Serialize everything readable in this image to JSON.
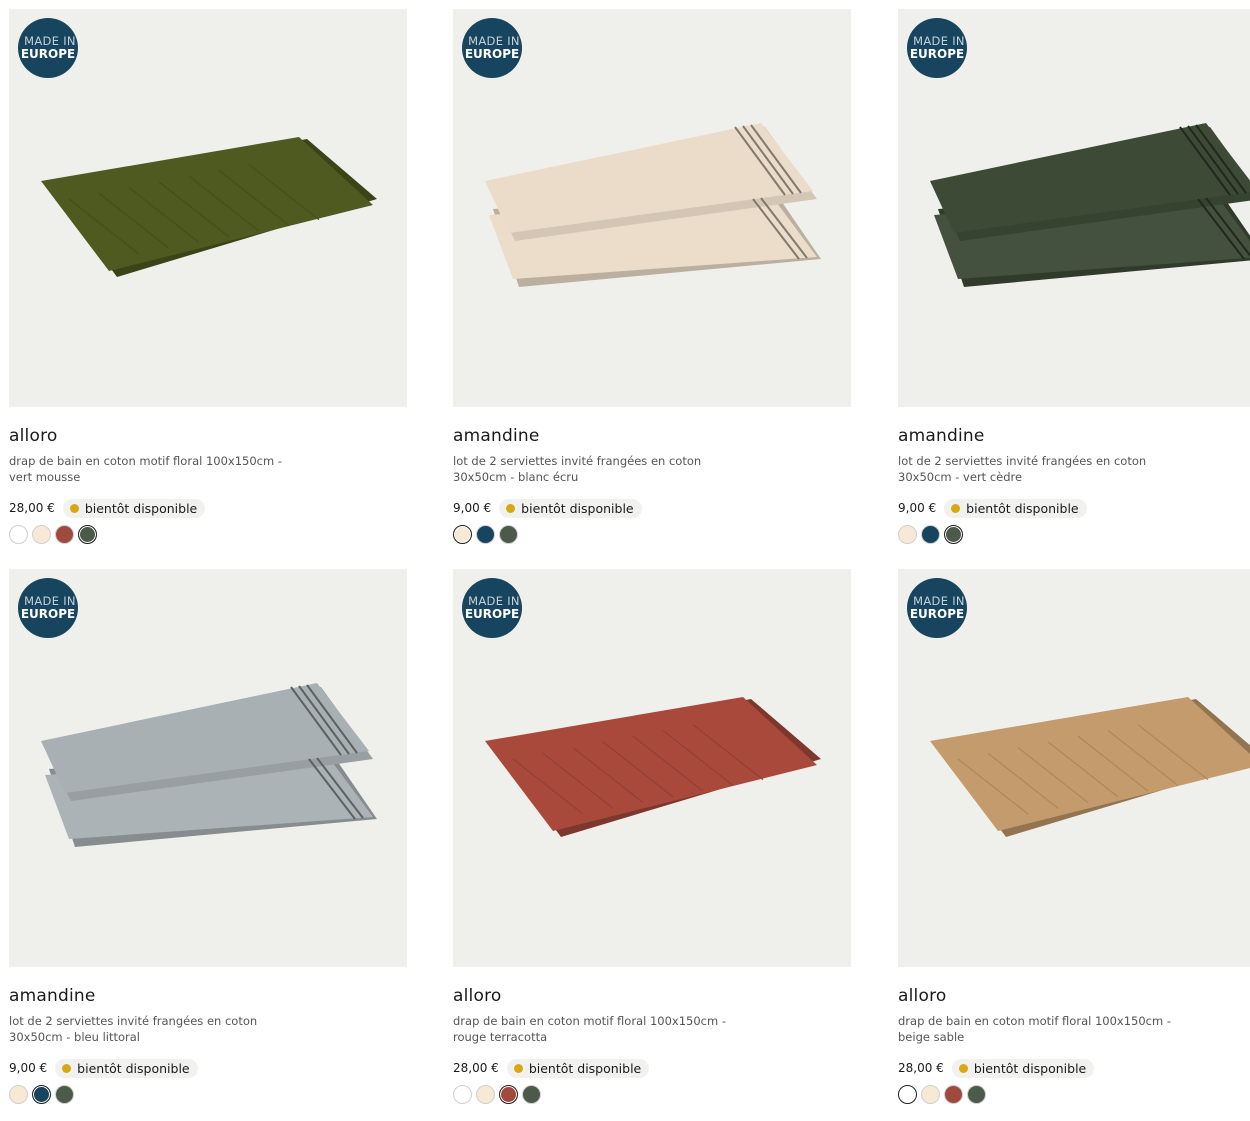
{
  "badge": {
    "line1": "MADE IN",
    "line2": "EUROPE"
  },
  "products": [
    {
      "title": "alloro",
      "desc": "drap de bain en coton motif floral 100x150cm - vert mousse",
      "price": "28,00 €",
      "stock": "bientôt disponible",
      "image_icon": "folded-bath-towel-image",
      "image_color": "#4e5a1f",
      "swatches": [
        {
          "color": "#ffffff",
          "selected": false
        },
        {
          "color": "#f8e9d6",
          "selected": false
        },
        {
          "color": "#a04a3e",
          "selected": false
        },
        {
          "color": "#4c5a4a",
          "selected": true
        }
      ]
    },
    {
      "title": "amandine",
      "desc": "lot de 2 serviettes invité frangées en coton 30x50cm - blanc écru",
      "price": "9,00 €",
      "stock": "bientôt disponible",
      "image_icon": "two-guest-towels-image",
      "image_color": "#eadcc8",
      "swatches": [
        {
          "color": "#f8e9d6",
          "selected": true
        },
        {
          "color": "#17445e",
          "selected": false
        },
        {
          "color": "#4c5a4a",
          "selected": false
        }
      ]
    },
    {
      "title": "amandine",
      "desc": "lot de 2 serviettes invité frangées en coton 30x50cm - vert cèdre",
      "price": "9,00 €",
      "stock": "bientôt disponible",
      "image_icon": "two-guest-towels-image",
      "image_color": "#3c4a36",
      "swatches": [
        {
          "color": "#f8e9d6",
          "selected": false
        },
        {
          "color": "#17445e",
          "selected": false
        },
        {
          "color": "#4c5a4a",
          "selected": true
        }
      ]
    },
    {
      "title": "amandine",
      "desc": "lot de 2 serviettes invité frangées en coton 30x50cm - bleu littoral",
      "price": "9,00 €",
      "stock": "bientôt disponible",
      "image_icon": "two-guest-towels-image",
      "image_color": "#a9b0b3",
      "swatches": [
        {
          "color": "#f8e9d6",
          "selected": false
        },
        {
          "color": "#17445e",
          "selected": true
        },
        {
          "color": "#4c5a4a",
          "selected": false
        }
      ]
    },
    {
      "title": "alloro",
      "desc": "drap de bain en coton motif floral 100x150cm - rouge terracotta",
      "price": "28,00 €",
      "stock": "bientôt disponible",
      "image_icon": "folded-bath-towel-image",
      "image_color": "#a8493b",
      "swatches": [
        {
          "color": "#ffffff",
          "selected": false
        },
        {
          "color": "#f8e9d6",
          "selected": false
        },
        {
          "color": "#a04a3e",
          "selected": true
        },
        {
          "color": "#4c5a4a",
          "selected": false
        }
      ]
    },
    {
      "title": "alloro",
      "desc": "drap de bain en coton motif floral 100x150cm - beige sable",
      "price": "28,00 €",
      "stock": "bientôt disponible",
      "image_icon": "folded-bath-towel-image",
      "image_color": "#c39b6c",
      "swatches": [
        {
          "color": "#ffffff",
          "selected": true
        },
        {
          "color": "#f8e9d6",
          "selected": false
        },
        {
          "color": "#a04a3e",
          "selected": false
        },
        {
          "color": "#4c5a4a",
          "selected": false
        }
      ]
    }
  ]
}
